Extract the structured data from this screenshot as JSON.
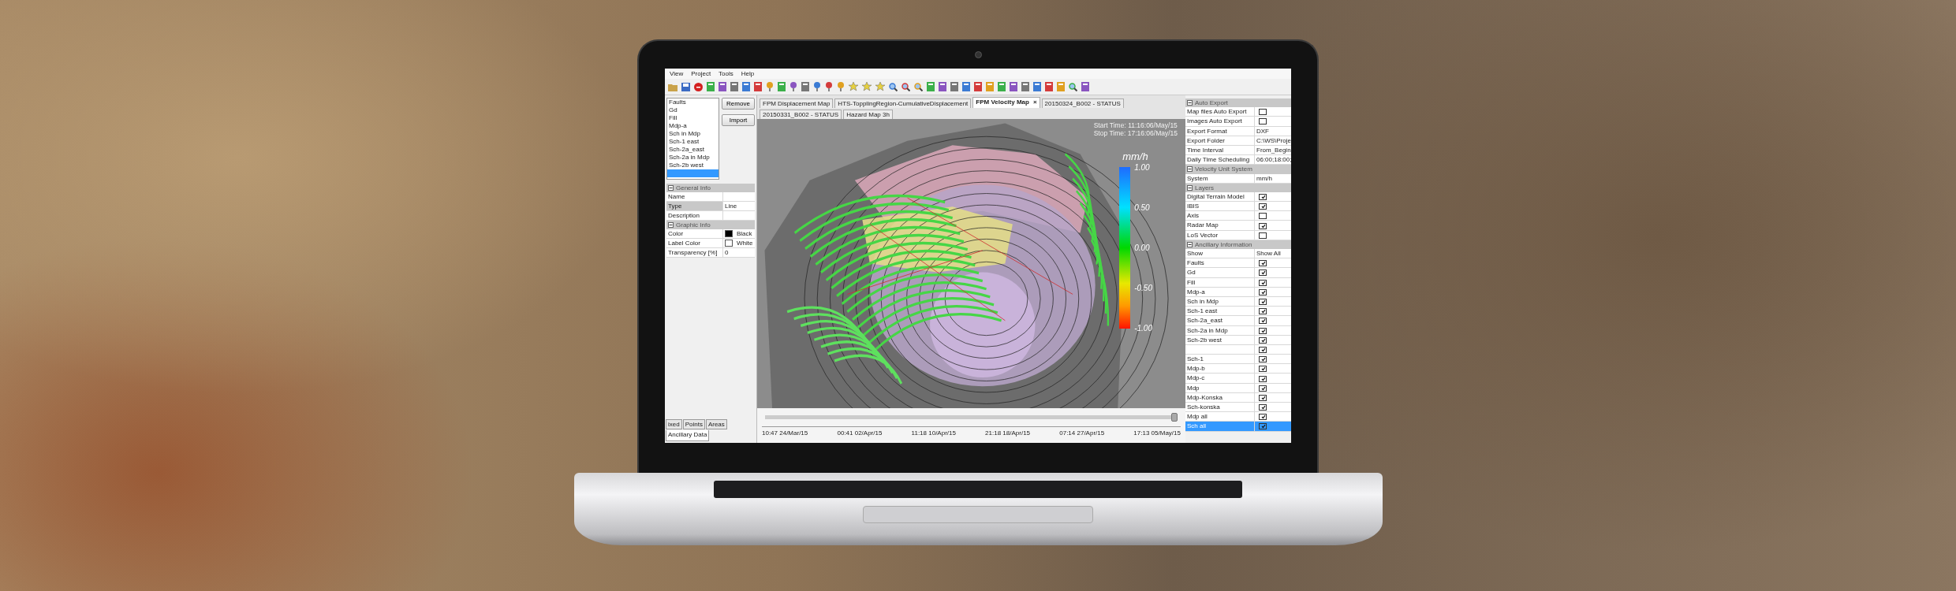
{
  "menu_bar": [
    "View",
    "Project",
    "Tools",
    "Help"
  ],
  "layer_list": [
    {
      "label": "Faults",
      "selected": false
    },
    {
      "label": "Gd",
      "selected": false
    },
    {
      "label": "Fill",
      "selected": false
    },
    {
      "label": "Mdp-a",
      "selected": false
    },
    {
      "label": "Sch in Mdp",
      "selected": false
    },
    {
      "label": "Sch-1 east",
      "selected": false
    },
    {
      "label": "Sch-2a_east",
      "selected": false
    },
    {
      "label": "Sch-2a in Mdp",
      "selected": false
    },
    {
      "label": "Sch-2b west",
      "selected": false
    },
    {
      "selected": true
    }
  ],
  "layer_buttons": [
    "Remove",
    "Import"
  ],
  "properties": [
    {
      "title": "General Info",
      "expanded": true,
      "rows": [
        {
          "name": "Name",
          "selected": false
        },
        {
          "name": "Type",
          "value": "Line",
          "selected": true
        },
        {
          "name": "Description",
          "selected": false
        }
      ]
    },
    {
      "title": "Graphic Info",
      "expanded": true,
      "rows": [
        {
          "name": "Color",
          "value": "Black",
          "color": "#000000",
          "selected": false
        },
        {
          "name": "Label Color",
          "value": "White",
          "color": "#ffffff",
          "selected": false
        },
        {
          "name": "Transparency [%]",
          "value": "0",
          "selected": false
        }
      ]
    }
  ],
  "panel_tabs": [
    {
      "label": "ixed",
      "selected": false
    },
    {
      "label": "Points",
      "selected": false
    },
    {
      "label": "Areas",
      "selected": false
    },
    {
      "label": "Ancillary Data",
      "selected": true
    }
  ],
  "map_tabs": [
    {
      "label": "FPM Displacement Map",
      "selected": false
    },
    {
      "label": "HTS-TopplingRegion-CumulativeDisplacement",
      "selected": false
    },
    {
      "label": "FPM Velocity Map",
      "selected": true,
      "close": "×"
    },
    {
      "label": "20150324_B002 - STATUS",
      "selected": false
    },
    {
      "label": "20150331_B002 - STATUS",
      "selected": false
    },
    {
      "label": "Hazard Map 3h",
      "selected": false
    }
  ],
  "map": {
    "start_time": "Start Time: 11:16:06/May/15",
    "stop_time": "Stop Time: 17:16:06/May/15",
    "legend": {
      "unit": "mm/h",
      "labels": [
        "1.00",
        "0.50",
        "0.00",
        "-0.50",
        "-1.00"
      ]
    }
  },
  "timeline": {
    "level": 1,
    "labels": [
      "10:47 24/Mar/15",
      "00:41 02/Apr/15",
      "11:18 10/Apr/15",
      "21:18 18/Apr/15",
      "07:14 27/Apr/15",
      "17:13 05/May/15"
    ]
  },
  "settings": [
    {
      "title": "Auto Export",
      "expanded": true,
      "rows": [
        {
          "name": "Map files Auto Export",
          "kind": "checkbox",
          "checked": false,
          "selected": false
        },
        {
          "name": "Images Auto Export",
          "kind": "checkbox",
          "checked": false,
          "selected": false
        },
        {
          "name": "Export Format",
          "kind": "text",
          "value": "DXF",
          "selected": false
        },
        {
          "name": "Export Folder",
          "kind": "text",
          "value": "C:\\WS\\Proje",
          "selected": false
        },
        {
          "name": "Time Interval",
          "kind": "text",
          "value": "From_Begin",
          "selected": false
        },
        {
          "name": "Daily Time Scheduling",
          "kind": "text",
          "value": "06:00;18:00;",
          "selected": false
        }
      ]
    },
    {
      "title": "Velocity Unit System",
      "expanded": true,
      "rows": [
        {
          "name": "System",
          "kind": "text",
          "value": "mm/h",
          "selected": false
        }
      ]
    },
    {
      "title": "Layers",
      "expanded": true,
      "rows": [
        {
          "name": "Digital Terrain Model",
          "kind": "checkbox",
          "checked": true,
          "selected": false
        },
        {
          "name": "IBIS",
          "kind": "checkbox",
          "checked": true,
          "selected": false
        },
        {
          "name": "Axis",
          "kind": "checkbox",
          "checked": false,
          "selected": false
        },
        {
          "name": "Radar Map",
          "kind": "checkbox",
          "checked": true,
          "selected": false
        },
        {
          "name": "LoS Vector",
          "kind": "checkbox",
          "checked": false,
          "selected": false
        }
      ]
    },
    {
      "title": "Ancillary Information",
      "expanded": true,
      "rows": [
        {
          "name": "Show",
          "kind": "text",
          "value": "Show All",
          "selected": false
        },
        {
          "name": "Faults",
          "kind": "checkbox",
          "checked": true,
          "selected": false
        },
        {
          "name": "Gd",
          "kind": "checkbox",
          "checked": true,
          "selected": false
        },
        {
          "name": "Fill",
          "kind": "checkbox",
          "checked": true,
          "selected": false
        },
        {
          "name": "Mdp-a",
          "kind": "checkbox",
          "checked": true,
          "selected": false
        },
        {
          "name": "Sch in Mdp",
          "kind": "checkbox",
          "checked": true,
          "selected": false
        },
        {
          "name": "Sch-1 east",
          "kind": "checkbox",
          "checked": true,
          "selected": false
        },
        {
          "name": "Sch-2a_east",
          "kind": "checkbox",
          "checked": true,
          "selected": false
        },
        {
          "name": "Sch-2a in Mdp",
          "kind": "checkbox",
          "checked": true,
          "selected": false
        },
        {
          "name": "Sch-2b west",
          "kind": "checkbox",
          "checked": true,
          "selected": false
        },
        {
          "kind": "checkbox",
          "checked": true,
          "selected": false
        },
        {
          "name": "Sch-1",
          "kind": "checkbox",
          "checked": true,
          "selected": false
        },
        {
          "name": "Mdp-b",
          "kind": "checkbox",
          "checked": true,
          "selected": false
        },
        {
          "name": "Mdp-c",
          "kind": "checkbox",
          "checked": true,
          "selected": false
        },
        {
          "name": "Mdp",
          "kind": "checkbox",
          "checked": true,
          "selected": false
        },
        {
          "name": "Mdp-Konska",
          "kind": "checkbox",
          "checked": true,
          "selected": false
        },
        {
          "name": "Sch-konska",
          "kind": "checkbox",
          "checked": true,
          "selected": false
        },
        {
          "name": "Mdp all",
          "kind": "checkbox",
          "checked": true,
          "selected": false
        },
        {
          "name": "Sch all",
          "kind": "checkbox",
          "checked": true,
          "selected": true
        }
      ]
    }
  ]
}
